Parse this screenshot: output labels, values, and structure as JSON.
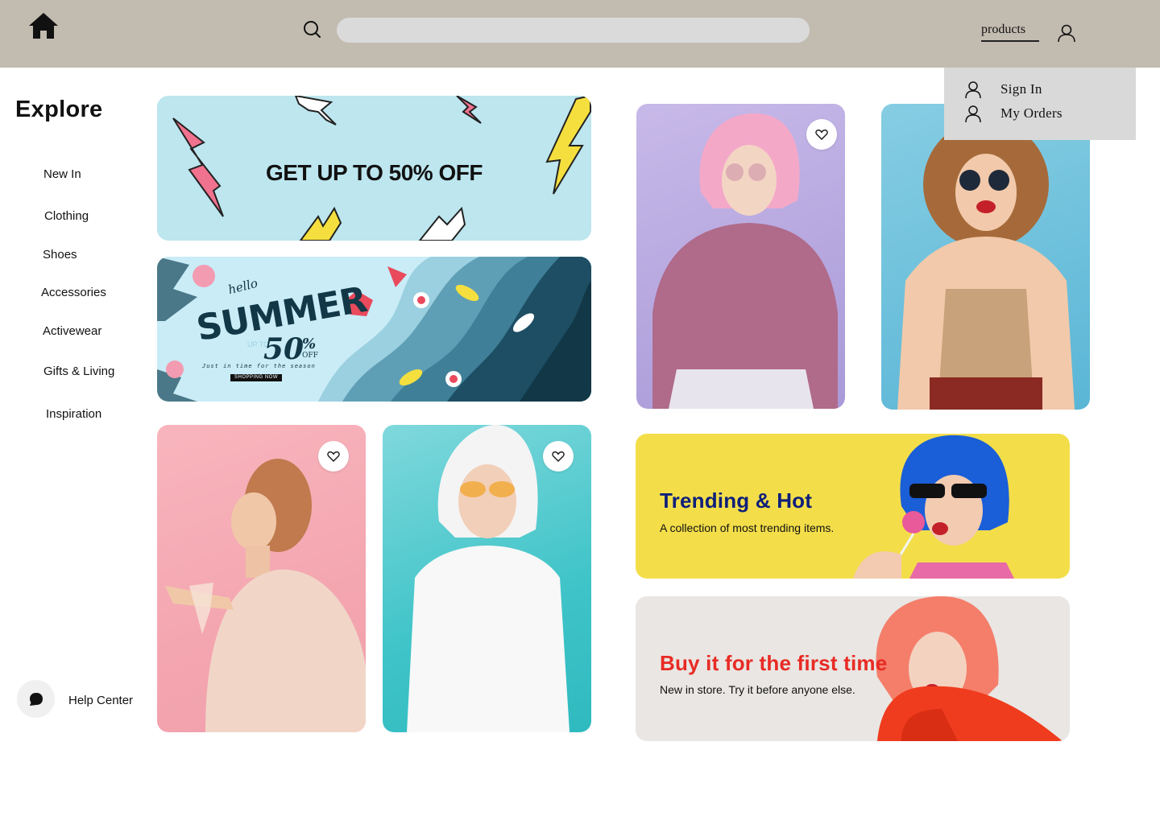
{
  "header": {
    "search_placeholder": "",
    "products_label": "products"
  },
  "dropdown": {
    "items": [
      {
        "label": "Sign  In"
      },
      {
        "label": "My  Orders"
      }
    ]
  },
  "sidebar": {
    "title": "Explore",
    "items": [
      {
        "label": "New In"
      },
      {
        "label": "Clothing"
      },
      {
        "label": "Shoes"
      },
      {
        "label": "Accessories"
      },
      {
        "label": "Activewear"
      },
      {
        "label": "Gifts & Living"
      },
      {
        "label": "Inspiration"
      }
    ],
    "help_label": "Help Center"
  },
  "promo": {
    "headline": "GET UP TO 50% OFF"
  },
  "summer": {
    "hello": "hello",
    "title": "SUMMER",
    "percent": "50",
    "pct_sign": "%",
    "off": "OFF",
    "up_to": "UP TO",
    "tagline": "Just in time for the season",
    "cta": "SHOPPING NOW"
  },
  "banners": {
    "trending": {
      "title": "Trending & Hot",
      "subtitle": "A collection of most trending items."
    },
    "first": {
      "title": "Buy it for the first time",
      "subtitle": "New in store. Try it before anyone else."
    }
  },
  "colors": {
    "topbar": "#c2bbb0",
    "dropdown": "#d9d9d9",
    "promo_bg": "#bde6ef",
    "trending_bg": "#f3de4a",
    "trending_title": "#0e1f7a",
    "first_bg": "#e9e6e3",
    "first_title": "#e82b24"
  }
}
